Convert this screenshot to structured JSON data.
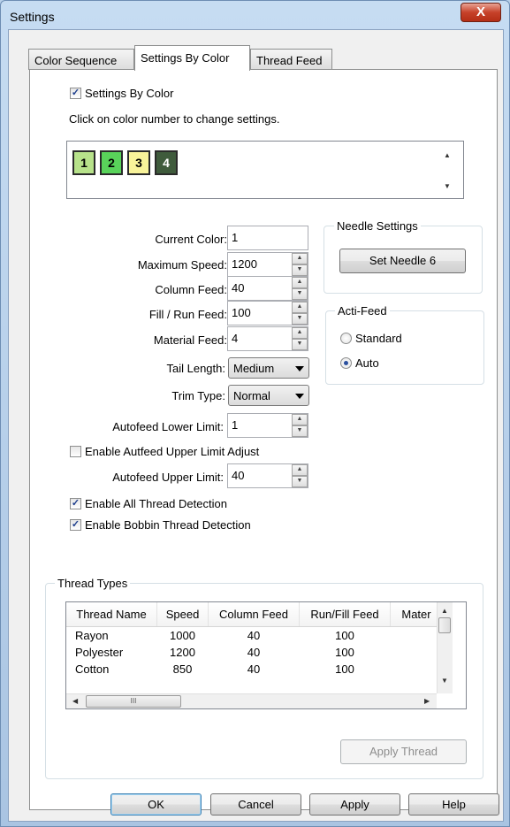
{
  "window": {
    "title": "Settings",
    "close_glyph": "X"
  },
  "tabs": [
    {
      "label": "Color Sequence",
      "active": false
    },
    {
      "label": "Settings By Color",
      "active": true
    },
    {
      "label": "Thread Feed",
      "active": false
    }
  ],
  "settings_by_color": {
    "checkbox_label": "Settings By Color",
    "checked": true,
    "hint": "Click on color number to change settings."
  },
  "color_numbers": [
    {
      "label": "1",
      "color": "#b7e28a",
      "text_color": "#000000"
    },
    {
      "label": "2",
      "color": "#59d35a",
      "text_color": "#000000"
    },
    {
      "label": "3",
      "color": "#f8f39a",
      "text_color": "#000000"
    },
    {
      "label": "4",
      "color": "#3f5b3c",
      "text_color": "#ffffff"
    }
  ],
  "fields": {
    "current_color": {
      "label": "Current Color:",
      "value": "1"
    },
    "maximum_speed": {
      "label": "Maximum Speed:",
      "value": "1200"
    },
    "column_feed": {
      "label": "Column Feed:",
      "value": "40"
    },
    "fill_run_feed": {
      "label": "Fill / Run Feed:",
      "value": "100"
    },
    "material_feed": {
      "label": "Material Feed:",
      "value": "4"
    },
    "tail_length": {
      "label": "Tail Length:",
      "value": "Medium"
    },
    "trim_type": {
      "label": "Trim Type:",
      "value": "Normal"
    },
    "autofeed_lower_limit": {
      "label": "Autofeed Lower Limit:",
      "value": "1"
    },
    "autofeed_upper_limit": {
      "label": "Autofeed Upper Limit:",
      "value": "40"
    }
  },
  "needle_settings": {
    "title": "Needle Settings",
    "button_label": "Set Needle 6"
  },
  "acti_feed": {
    "title": "Acti-Feed",
    "options": [
      {
        "label": "Standard",
        "selected": false
      },
      {
        "label": "Auto",
        "selected": true
      }
    ]
  },
  "checkboxes": {
    "enable_autofeed_upper": {
      "label": "Enable Autfeed Upper Limit Adjust",
      "checked": false
    },
    "enable_all_thread": {
      "label": "Enable All Thread Detection",
      "checked": true
    },
    "enable_bobbin_thread": {
      "label": "Enable Bobbin Thread Detection",
      "checked": true
    }
  },
  "thread_types": {
    "title": "Thread Types",
    "columns": [
      "Thread Name",
      "Speed",
      "Column Feed",
      "Run/Fill Feed",
      "Mater"
    ],
    "rows": [
      [
        "Rayon",
        "1000",
        "40",
        "100"
      ],
      [
        "Polyester",
        "1200",
        "40",
        "100"
      ],
      [
        "Cotton",
        "850",
        "40",
        "100"
      ]
    ],
    "apply_button": "Apply Thread",
    "hscroll_thumb_glyph": "III"
  },
  "footer_buttons": {
    "ok": "OK",
    "cancel": "Cancel",
    "apply": "Apply",
    "help": "Help"
  }
}
